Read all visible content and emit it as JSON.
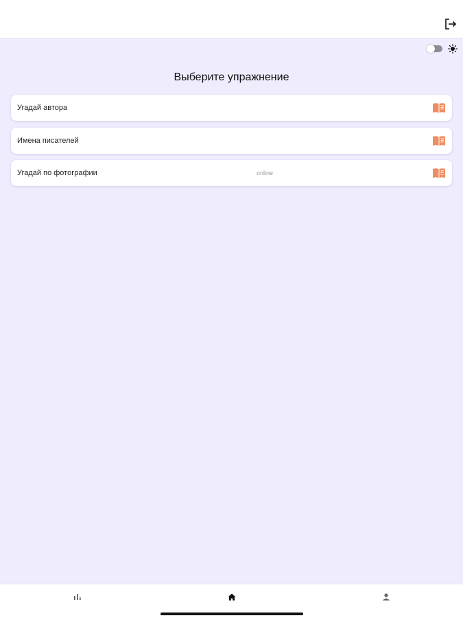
{
  "header": {
    "logout_icon": "logout-icon"
  },
  "theme": {
    "toggle_state": "off",
    "icon": "sun-icon"
  },
  "main": {
    "title": "Выберите упражнение",
    "exercises": [
      {
        "label": "Угадай автора",
        "badge": "",
        "icon": "book-icon"
      },
      {
        "label": "Имена писателей",
        "badge": "",
        "icon": "book-icon"
      },
      {
        "label": "Угадай по фотографии",
        "badge": "online",
        "icon": "book-icon"
      }
    ]
  },
  "bottom_nav": {
    "items": [
      {
        "icon": "stats-icon",
        "active": false
      },
      {
        "icon": "home-icon",
        "active": true
      },
      {
        "icon": "profile-icon",
        "active": false
      }
    ]
  },
  "colors": {
    "background": "#eeecfd",
    "card": "#ffffff",
    "accent": "#ef8d62"
  }
}
